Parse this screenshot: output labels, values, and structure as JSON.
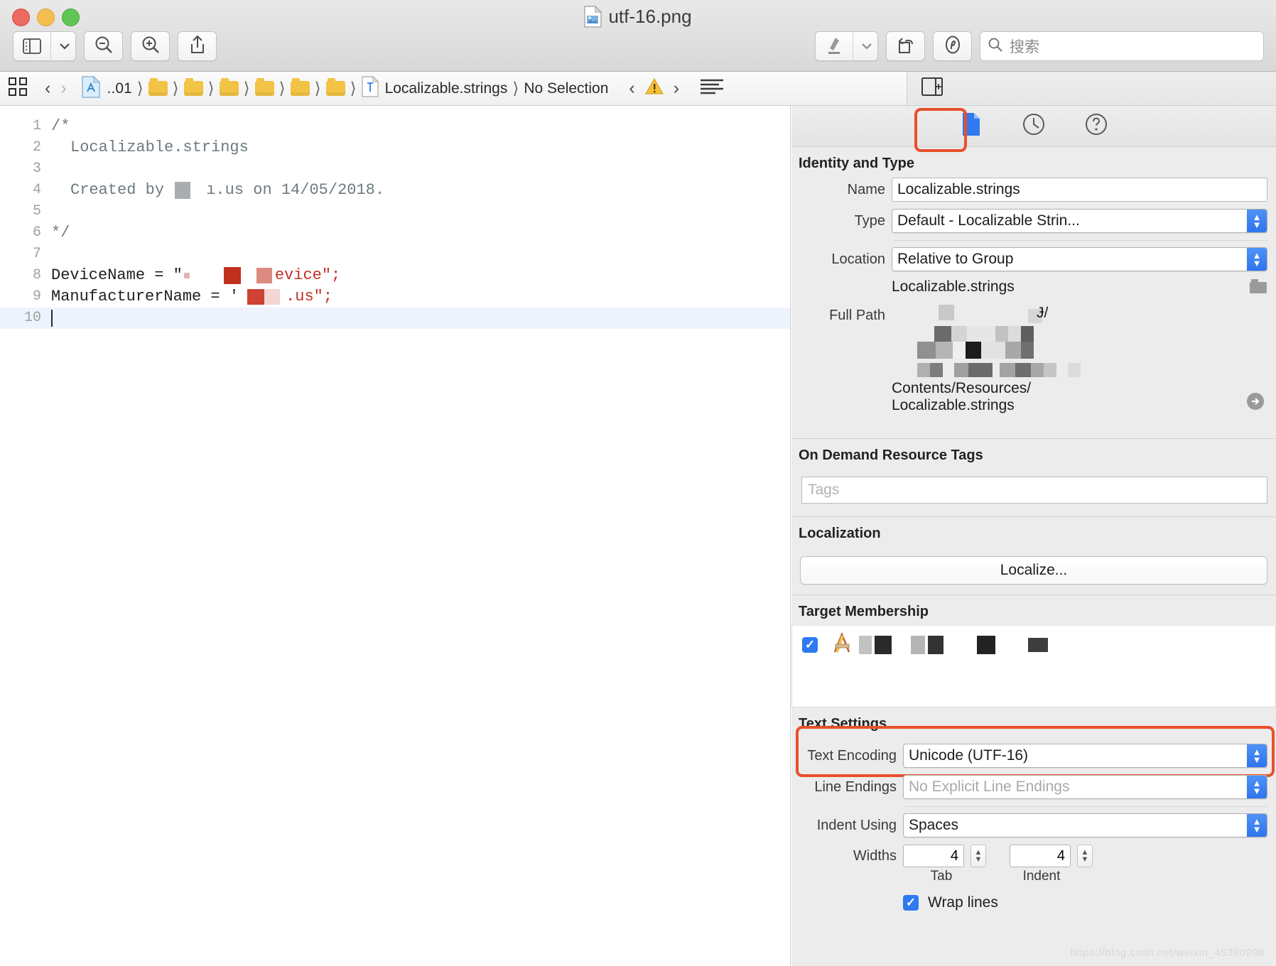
{
  "window": {
    "app": "Preview",
    "title": "utf-16.png",
    "traffic_lights": [
      "close",
      "minimize",
      "zoom"
    ]
  },
  "toolbar": {
    "left_buttons": [
      {
        "name": "sidebar-view",
        "icon": "sidebar-icon"
      },
      {
        "name": "zoom-out",
        "icon": "magnifier-minus-icon"
      },
      {
        "name": "zoom-in",
        "icon": "magnifier-plus-icon"
      },
      {
        "name": "share",
        "icon": "share-icon"
      }
    ],
    "right_buttons": [
      {
        "name": "markup",
        "icon": "pen-icon"
      },
      {
        "name": "markup-menu",
        "icon": "chevron-down-icon"
      },
      {
        "name": "rotate",
        "icon": "rotate-icon"
      },
      {
        "name": "annotate",
        "icon": "sign-icon"
      }
    ],
    "search_placeholder": "搜索"
  },
  "jumpbar": {
    "related_items_icon": "grid-icon",
    "back_label": "‹",
    "forward_label": "›",
    "project_crumb": "..01",
    "folder_crumbs": [
      "",
      "",
      "",
      "",
      "",
      ""
    ],
    "file_crumb": "Localizable.strings",
    "selection_crumb": "No Selection",
    "issue_prev": "‹",
    "issue_icon": "warning-triangle-icon",
    "issue_next": "›",
    "editor_options_icon": "lines-icon",
    "inspector_toggle_icon": "panel-right-icon"
  },
  "editor": {
    "lines": [
      {
        "num": "1",
        "indent": 0,
        "text": "/*",
        "cls": "cmt"
      },
      {
        "num": "2",
        "indent": 2,
        "text": "Localizable.strings",
        "cls": "cmt"
      },
      {
        "num": "3",
        "indent": 0,
        "text": "",
        "cls": "cmt"
      },
      {
        "num": "4",
        "indent": 2,
        "text": "Created by ",
        "cls": "cmt",
        "redacted": true,
        "tail": " ı.us on 14/05/2018."
      },
      {
        "num": "5",
        "indent": 0,
        "text": "",
        "cls": "cmt"
      },
      {
        "num": "6",
        "indent": 0,
        "text": "*/",
        "cls": "cmt"
      },
      {
        "num": "7",
        "indent": 0,
        "text": "",
        "cls": "cmt"
      },
      {
        "num": "8",
        "indent": 0,
        "code": "DeviceName = ",
        "quote": "\"",
        "redactedstr": true,
        "tail": "evice\";"
      },
      {
        "num": "9",
        "indent": 0,
        "code": "ManufacturerName = ",
        "quote": "'",
        "redactedstr2": true,
        "tail": ".us\";"
      },
      {
        "num": "10",
        "indent": 0,
        "text": "",
        "caret": true,
        "selected": true
      }
    ],
    "line_8_text": "DeviceName = \"",
    "line_8_tail": "evice\";",
    "line_9_text": "ManufacturerName = '",
    "line_9_tail": ".us\";",
    "line_4_prefix": "Created by ",
    "line_4_tail": "ı.us on 14/05/2018."
  },
  "inspector": {
    "tabs": [
      {
        "name": "file-inspector",
        "icon": "document-icon",
        "selected": true,
        "highlighted": true
      },
      {
        "name": "history-inspector",
        "icon": "clock-icon",
        "selected": false
      },
      {
        "name": "quick-help-inspector",
        "icon": "question-circle-icon",
        "selected": false
      }
    ],
    "identity": {
      "title": "Identity and Type",
      "name_label": "Name",
      "name_value": "Localizable.strings",
      "type_label": "Type",
      "type_value": "Default - Localizable Strin...",
      "location_label": "Location",
      "location_value": "Relative to Group",
      "location_file": "Localizable.strings",
      "full_path_label": "Full Path",
      "full_path_tail_1": "Ɉ/",
      "full_path_line_a": "Contents/Resources/",
      "full_path_line_b": "Localizable.strings",
      "reveal_icon": "arrow-right-circle-icon",
      "choose_folder_icon": "folder-icon"
    },
    "odr": {
      "title": "On Demand Resource Tags",
      "tags_placeholder": "Tags"
    },
    "localization": {
      "title": "Localization",
      "button_label": "Localize..."
    },
    "target_membership": {
      "title": "Target Membership",
      "items": [
        {
          "checked": true,
          "icon": "xcode-target-icon",
          "label": ""
        }
      ]
    },
    "text_settings": {
      "title": "Text Settings",
      "encoding_label": "Text Encoding",
      "encoding_value": "Unicode (UTF-16)",
      "encoding_highlighted": true,
      "line_endings_label": "Line Endings",
      "line_endings_value": "No Explicit Line Endings",
      "indent_label": "Indent Using",
      "indent_value": "Spaces",
      "widths_label": "Widths",
      "tab_value": "4",
      "indent_value_num": "4",
      "tab_sublabel": "Tab",
      "indent_sublabel": "Indent",
      "wrap_label": "Wrap lines",
      "wrap_checked": true
    }
  },
  "watermark": "https://blog.csdn.net/weixin_45390998",
  "colors": {
    "highlight": "#e8502a",
    "accent_blue": "#2f7af0",
    "string_red": "#c23127",
    "comment_grey": "#6d7a80",
    "selection_blue": "#eef4fd"
  }
}
